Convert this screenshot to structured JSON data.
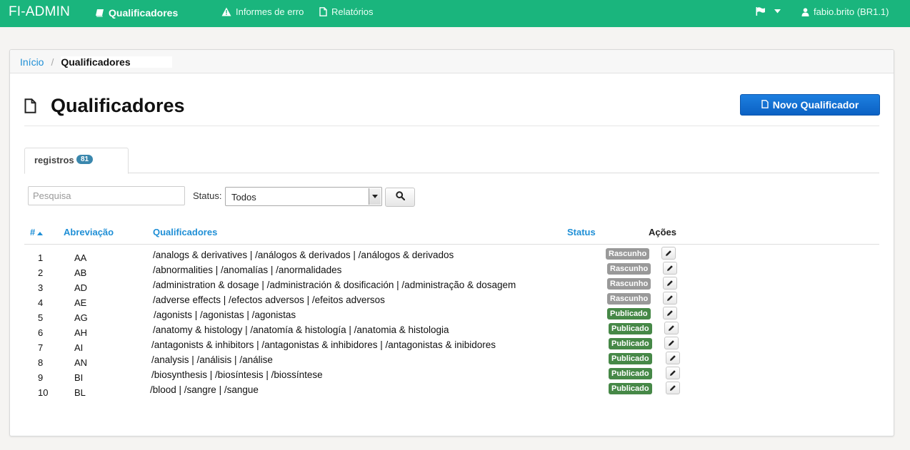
{
  "navbar": {
    "brand": "FI-ADMIN",
    "items": [
      {
        "label": "Qualificadores",
        "icon": "book-icon"
      },
      {
        "label": "Informes de erro",
        "icon": "warning-icon"
      },
      {
        "label": "Relatórios",
        "icon": "file-icon"
      }
    ],
    "user_label": "fabio.brito (BR1.1)"
  },
  "breadcrumb": {
    "home": "Início",
    "separator": "/",
    "current": "Qualificadores"
  },
  "page": {
    "title": "Qualificadores",
    "new_button": "Novo Qualificador"
  },
  "tabs": [
    {
      "label": "registros",
      "count": "81"
    }
  ],
  "filters": {
    "search_placeholder": "Pesquisa",
    "search_value": "",
    "status_label": "Status:",
    "status_selected": "Todos"
  },
  "table": {
    "headers": {
      "num": "#",
      "abbr": "Abreviação",
      "qual": "Qualificadores",
      "status": "Status",
      "actions": "Ações"
    },
    "rows": [
      {
        "num": "1",
        "abbr": "AA",
        "qual": "/analogs & derivatives | /análogos & derivados | /análogos & derivados",
        "status": "Rascunho",
        "status_type": "draft"
      },
      {
        "num": "2",
        "abbr": "AB",
        "qual": "/abnormalities | /anomalías | /anormalidades",
        "status": "Rascunho",
        "status_type": "draft"
      },
      {
        "num": "3",
        "abbr": "AD",
        "qual": "/administration & dosage | /administración & dosificación | /administração & dosagem",
        "status": "Rascunho",
        "status_type": "draft"
      },
      {
        "num": "4",
        "abbr": "AE",
        "qual": "/adverse effects | /efectos adversos | /efeitos adversos",
        "status": "Rascunho",
        "status_type": "draft"
      },
      {
        "num": "5",
        "abbr": "AG",
        "qual": "/agonists | /agonistas | /agonistas",
        "status": "Publicado",
        "status_type": "published"
      },
      {
        "num": "6",
        "abbr": "AH",
        "qual": "/anatomy & histology | /anatomía & histología | /anatomia & histologia",
        "status": "Publicado",
        "status_type": "published"
      },
      {
        "num": "7",
        "abbr": "AI",
        "qual": "/antagonists & inhibitors | /antagonistas & inhibidores | /antagonistas & inibidores",
        "status": "Publicado",
        "status_type": "published"
      },
      {
        "num": "8",
        "abbr": "AN",
        "qual": "/analysis | /análisis | /análise",
        "status": "Publicado",
        "status_type": "published"
      },
      {
        "num": "9",
        "abbr": "BI",
        "qual": "/biosynthesis | /biosíntesis | /biossíntese",
        "status": "Publicado",
        "status_type": "published"
      },
      {
        "num": "10",
        "abbr": "BL",
        "qual": "/blood | /sangre | /sangue",
        "status": "Publicado",
        "status_type": "published"
      }
    ]
  },
  "colors": {
    "navbar": "#1ab57d",
    "link": "#1f8fd6",
    "primary_button": "#0b61c4",
    "badge_draft": "#999999",
    "badge_published": "#468847",
    "count_badge": "#3a87ad"
  }
}
